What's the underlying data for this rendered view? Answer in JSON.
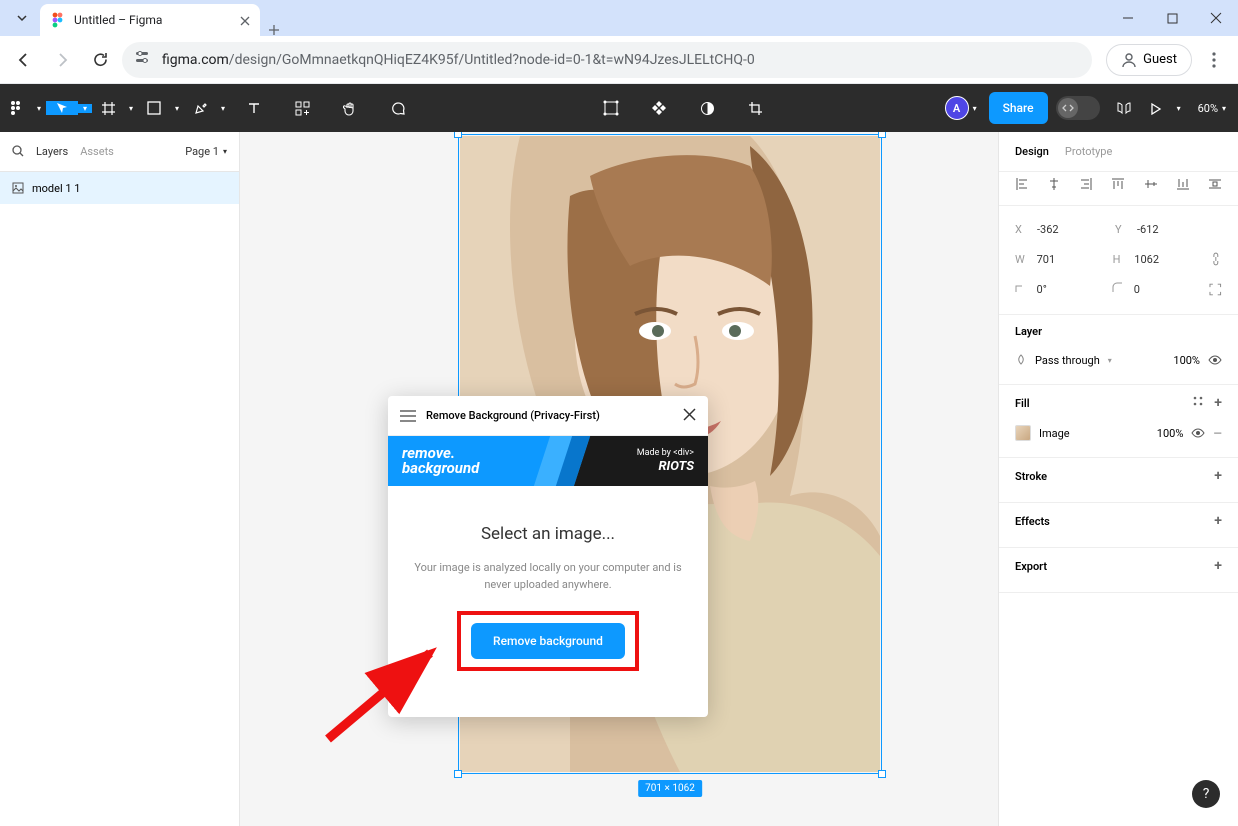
{
  "browser": {
    "tab_title": "Untitled – Figma",
    "url_domain": "figma.com",
    "url_path": "/design/GoMmnaetkqnQHiqEZ4K95f/Untitled?node-id=0-1&t=wN94JzesJLELtCHQ-0",
    "guest_label": "Guest"
  },
  "toolbar": {
    "avatar_initial": "A",
    "share_label": "Share",
    "zoom_label": "60%"
  },
  "left_panel": {
    "tab_layers": "Layers",
    "tab_assets": "Assets",
    "page_label": "Page 1",
    "layer_name": "model 1 1"
  },
  "canvas": {
    "dimensions_badge": "701 × 1062"
  },
  "plugin": {
    "title": "Remove Background (Privacy-First)",
    "banner_line1": "remove.",
    "banner_line2": "background",
    "made_by": "Made by",
    "brand_div": "<div>",
    "brand_riots": "RIOTS",
    "heading": "Select an image...",
    "description": "Your image is analyzed locally on your computer and is never uploaded anywhere.",
    "action_label": "Remove background"
  },
  "right_panel": {
    "tab_design": "Design",
    "tab_prototype": "Prototype",
    "x_label": "X",
    "x_value": "-362",
    "y_label": "Y",
    "y_value": "-612",
    "w_label": "W",
    "w_value": "701",
    "h_label": "H",
    "h_value": "1062",
    "rot_value": "0°",
    "radius_value": "0",
    "layer_title": "Layer",
    "blend_mode": "Pass through",
    "layer_opacity": "100%",
    "fill_title": "Fill",
    "fill_type": "Image",
    "fill_opacity": "100%",
    "stroke_title": "Stroke",
    "effects_title": "Effects",
    "export_title": "Export"
  },
  "help_label": "?"
}
